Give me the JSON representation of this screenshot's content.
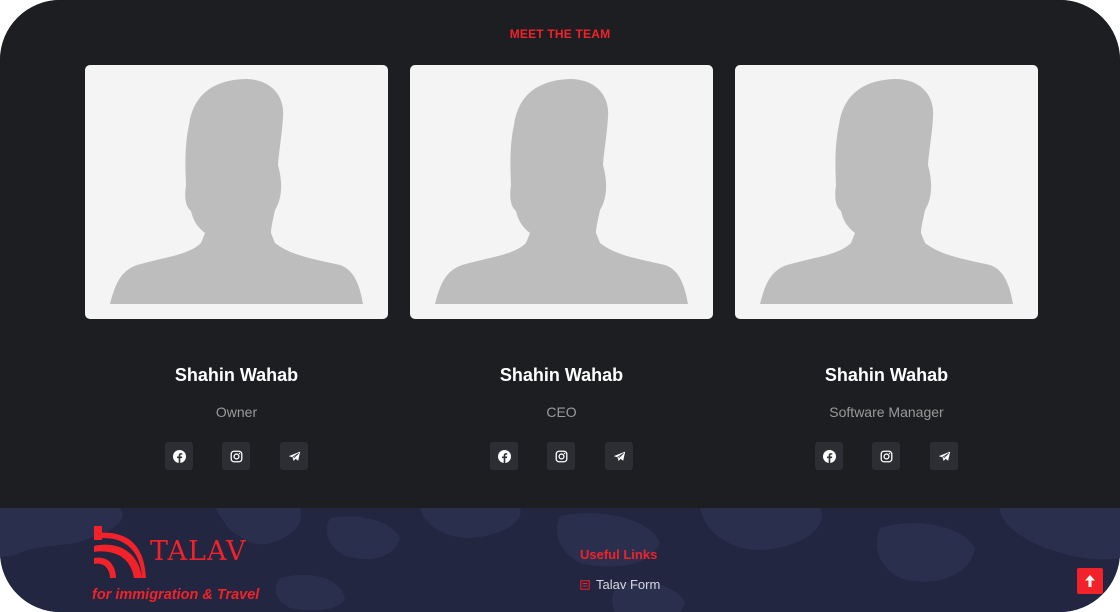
{
  "team": {
    "title": "MEET THE TEAM",
    "members": [
      {
        "name": "Shahin Wahab",
        "role": "Owner"
      },
      {
        "name": "Shahin Wahab",
        "role": "CEO"
      },
      {
        "name": "Shahin Wahab",
        "role": "Software Manager"
      }
    ],
    "social_icons": [
      "facebook-icon",
      "instagram-icon",
      "telegram-icon"
    ]
  },
  "footer": {
    "logo_word": "TALAV",
    "logo_tagline": "for immigration & Travel",
    "useful_links_title": "Useful Links",
    "links": [
      {
        "label": "Talav Form",
        "icon": "form-icon"
      }
    ]
  },
  "colors": {
    "accent": "#f2222a",
    "section_bg": "#1c1e21",
    "footer_bg": "#222640",
    "card_bg": "#f4f4f4",
    "silhouette": "#bdbdbd"
  }
}
